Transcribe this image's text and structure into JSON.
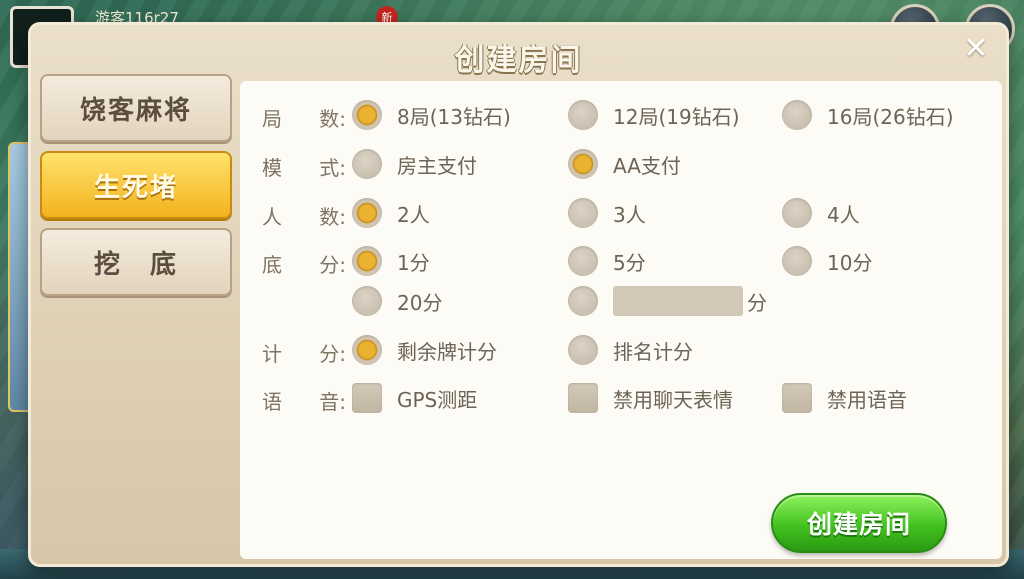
{
  "background": {
    "player_name": "游客116r27",
    "badge": "新"
  },
  "dialog": {
    "title": "创建房间",
    "close_label": "✕"
  },
  "tabs": [
    {
      "label": "饶客麻将",
      "active": false
    },
    {
      "label": "生死堵",
      "active": true
    },
    {
      "label": "挖　底",
      "active": false
    }
  ],
  "options": {
    "rounds": {
      "label_a": "局",
      "label_b": "数:",
      "choices": [
        "8局(13钻石)",
        "12局(19钻石)",
        "16局(26钻石)"
      ],
      "selected": "8局(13钻石)"
    },
    "mode": {
      "label_a": "模",
      "label_b": "式:",
      "choices": [
        "房主支付",
        "AA支付"
      ],
      "selected": "AA支付"
    },
    "players": {
      "label_a": "人",
      "label_b": "数:",
      "choices": [
        "2人",
        "3人",
        "4人"
      ],
      "selected": "2人"
    },
    "base_score": {
      "label_a": "底",
      "label_b": "分:",
      "choices": [
        "1分",
        "5分",
        "10分",
        "20分"
      ],
      "selected": "1分",
      "custom_input_value": "",
      "custom_unit": "分"
    },
    "scoring": {
      "label_a": "计",
      "label_b": "分:",
      "choices": [
        "剩余牌计分",
        "排名计分"
      ],
      "selected": "剩余牌计分"
    },
    "voice": {
      "label_a": "语",
      "label_b": "音:",
      "checkboxes": [
        "GPS测距",
        "禁用聊天表情",
        "禁用语音"
      ],
      "checked": []
    }
  },
  "create_button_label": "创建房间",
  "colors": {
    "accent_gold": "#f3b21e",
    "create_green": "#43c21f",
    "panel_bg": "#fdfbf5"
  }
}
